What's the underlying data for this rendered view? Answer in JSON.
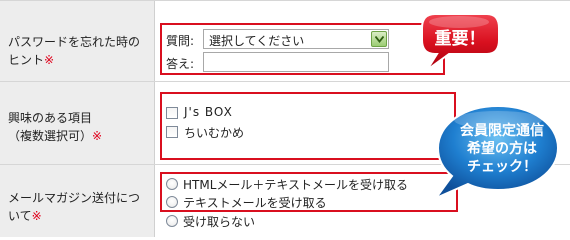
{
  "rows": [
    {
      "label_lines": [
        "パスワードを忘れた時の",
        "ヒント"
      ],
      "required_mark": "※",
      "question_label": "質問:",
      "select_value": "選択してください",
      "answer_label": "答え:",
      "answer_value": ""
    },
    {
      "label_lines": [
        "興味のある項目",
        "（複数選択可）"
      ],
      "required_mark": "※",
      "checkbox_options": [
        "J's BOX",
        "ちいむかめ"
      ]
    },
    {
      "label_lines": [
        "メールマガジン送付につ",
        "いて"
      ],
      "required_mark": "※",
      "radio_options": [
        "HTMLメール＋テキストメールを受け取る",
        "テキストメールを受け取る",
        "受け取らない"
      ]
    }
  ],
  "badges": {
    "important": "重要！",
    "member_lines": [
      "会員限定通信",
      "希望の方は",
      "チェック！"
    ]
  },
  "colors": {
    "label_bg": "#ededed",
    "highlight_border": "#d90f1f",
    "required": "#e0001b",
    "badge_red": "#d9101f",
    "badge_blue": "#1f7fd0"
  }
}
